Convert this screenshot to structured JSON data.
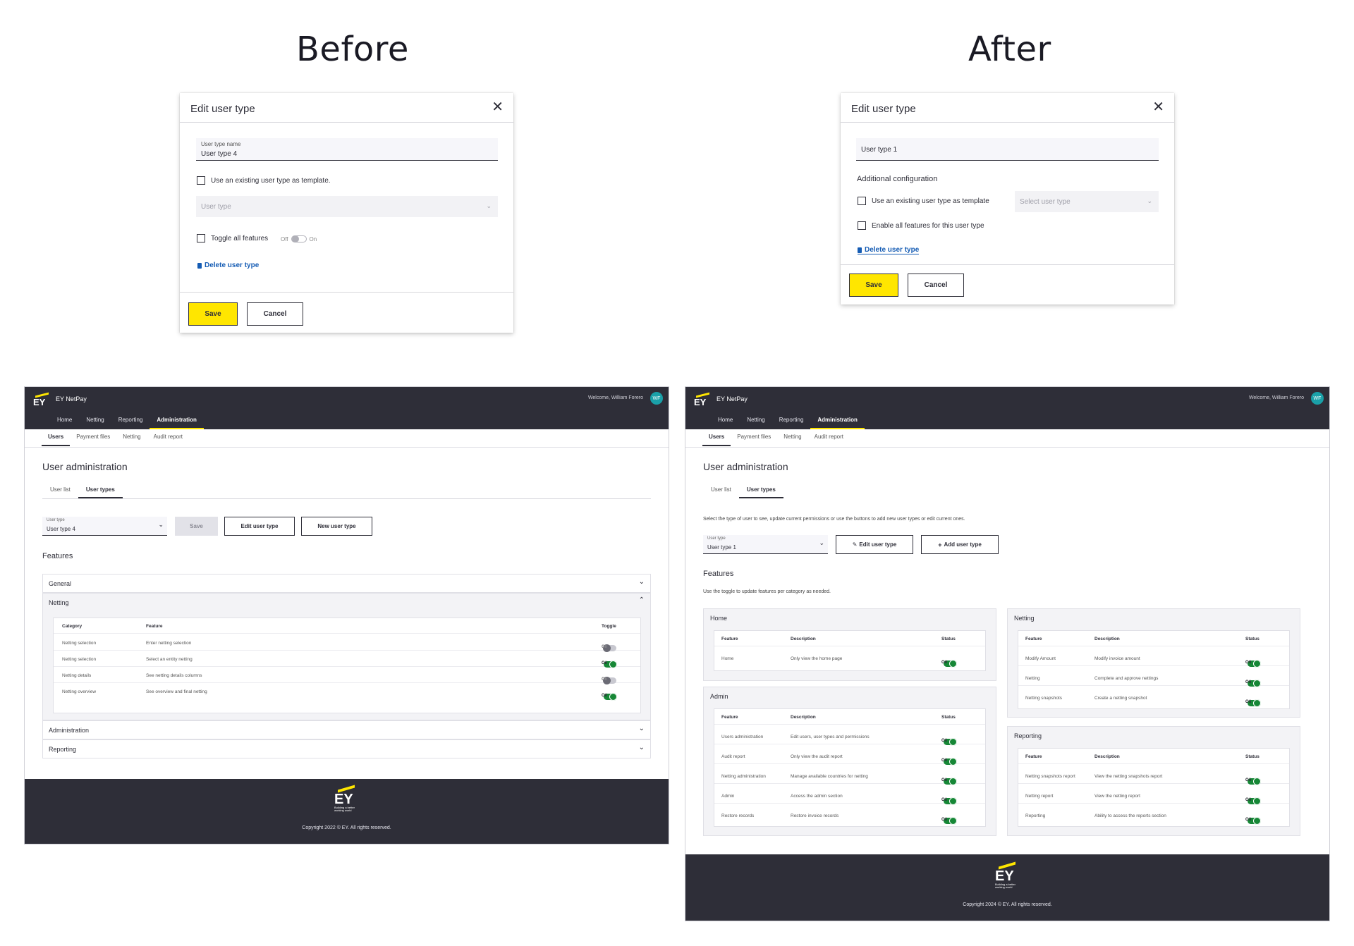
{
  "headings": {
    "before": "Before",
    "after": "After"
  },
  "modal_before": {
    "title": "Edit user type",
    "name_label": "User type name",
    "name_value": "User type 4",
    "template_checkbox": "Use an existing user type as template.",
    "user_type_placeholder": "User type",
    "toggle_label": "Toggle all features",
    "toggle_off": "Off",
    "toggle_on": "On",
    "delete_link": "Delete user type",
    "save": "Save",
    "cancel": "Cancel"
  },
  "modal_after": {
    "title": "Edit user type",
    "name_value": "User type 1",
    "section": "Additional configuration",
    "template_checkbox": "Use an existing user type as template",
    "select_placeholder": "Select user type",
    "enable_checkbox": "Enable all features for this user type",
    "delete_link": "Delete user type",
    "save": "Save",
    "cancel": "Cancel"
  },
  "app_common": {
    "app_name": "EY NetPay",
    "welcome": "Welcome, William Forero",
    "avatar": "WF",
    "nav": [
      "Home",
      "Netting",
      "Reporting",
      "Administration"
    ],
    "subnav": [
      "Users",
      "Payment files",
      "Netting",
      "Audit report"
    ],
    "page_title": "User administration",
    "tabs": [
      "User list",
      "User types"
    ],
    "features_title": "Features",
    "logo": "EY",
    "tagline": "Building a better working world"
  },
  "app_before": {
    "dropdown_label": "User type",
    "dropdown_value": "User type 4",
    "save": "Save",
    "edit": "Edit user type",
    "new": "New user type",
    "accordions": [
      "General",
      "Netting",
      "Administration",
      "Reporting"
    ],
    "table_headers": [
      "Category",
      "Feature",
      "Toggle"
    ],
    "rows": [
      {
        "category": "Netting selection",
        "feature": "Enter netting selection",
        "state": "off"
      },
      {
        "category": "Netting selection",
        "feature": "Select an entity netting",
        "state": "on"
      },
      {
        "category": "Netting details",
        "feature": "See netting details columns",
        "state": "off"
      },
      {
        "category": "Netting overview",
        "feature": "See overview and final netting",
        "state": "on"
      }
    ],
    "off": "Off",
    "on": "On",
    "copyright": "Copyright 2022 © EY. All rights reserved."
  },
  "app_after": {
    "intro": "Select the type of user to see, update current permissions or use the buttons to add new user types or edit current ones.",
    "dropdown_label": "User type",
    "dropdown_value": "User type 1",
    "edit": "Edit user type",
    "add": "Add user type",
    "features_desc": "Use the toggle to update features per category as needed.",
    "table_headers": [
      "Feature",
      "Description",
      "Status"
    ],
    "off": "Off",
    "on": "On",
    "cards": {
      "home": {
        "title": "Home",
        "rows": [
          [
            "Home",
            "Only view the home page"
          ]
        ]
      },
      "admin": {
        "title": "Admin",
        "rows": [
          [
            "Users administration",
            "Edit users, user types and permissions"
          ],
          [
            "Audit report",
            "Only view the audit report"
          ],
          [
            "Netting administration",
            "Manage available countries for netting"
          ],
          [
            "Admin",
            "Access the admin section"
          ],
          [
            "Restore records",
            "Restore invoice records"
          ]
        ]
      },
      "netting": {
        "title": "Netting",
        "rows": [
          [
            "Modify Amount",
            "Modify invoice amount"
          ],
          [
            "Netting",
            "Complete and approve nettings"
          ],
          [
            "Netting snapshots",
            "Create a netting snapshot"
          ]
        ]
      },
      "reporting": {
        "title": "Reporting",
        "rows": [
          [
            "Netting snapshots report",
            "View the netting snapshots report"
          ],
          [
            "Netting report",
            "View the netting report"
          ],
          [
            "Reporting",
            "Ability to access the reports section"
          ]
        ]
      }
    },
    "copyright": "Copyright 2024 © EY. All rights reserved."
  },
  "colors": {
    "ey_yellow": "#ffe600",
    "ey_dark": "#2e2e38",
    "toggle_on": "#168736",
    "link": "#155cb4"
  }
}
